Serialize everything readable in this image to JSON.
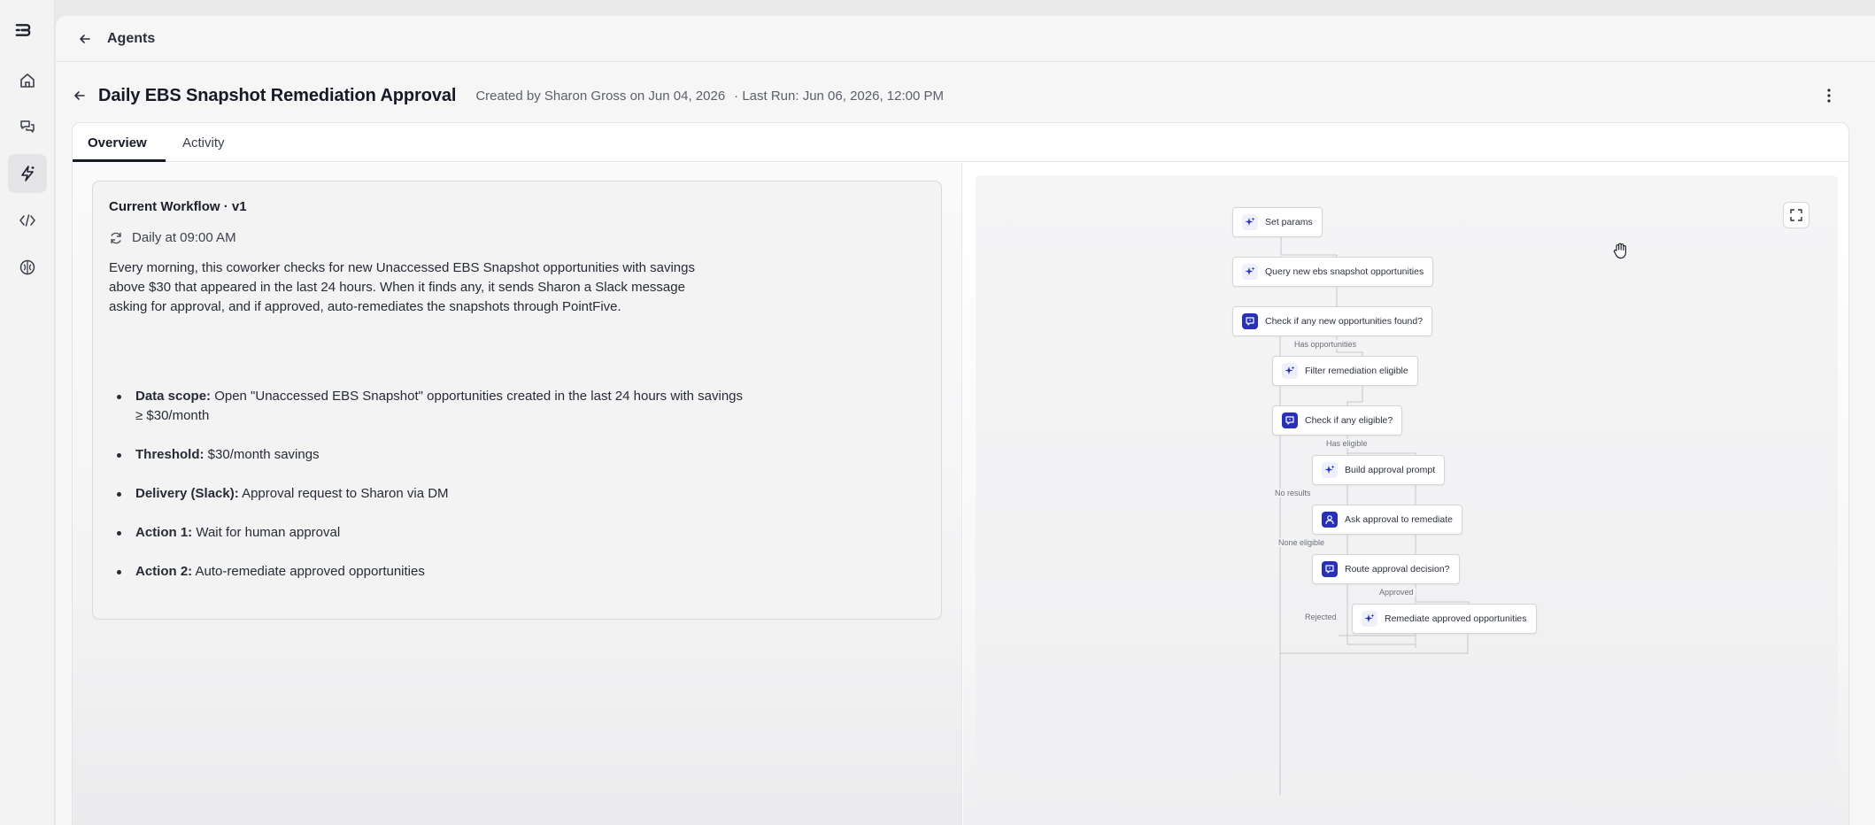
{
  "nav": {
    "items": [
      {
        "name": "home",
        "icon": "home-icon"
      },
      {
        "name": "chat",
        "icon": "chat-bubbles-icon"
      },
      {
        "name": "agents",
        "icon": "lightning-sparkle-icon",
        "active": true
      },
      {
        "name": "code",
        "icon": "code-brackets-icon"
      },
      {
        "name": "brain",
        "icon": "brain-icon"
      }
    ]
  },
  "topbar": {
    "breadcrumb": "Agents"
  },
  "header": {
    "title": "Daily EBS Snapshot Remediation Approval",
    "created": "Created by Sharon Gross on Jun 04, 2026",
    "last_run": "· Last Run: Jun 06, 2026, 12:00 PM"
  },
  "tabs": [
    {
      "label": "Overview",
      "active": true
    },
    {
      "label": "Activity",
      "active": false
    }
  ],
  "workflow": {
    "title": "Current Workflow · v1",
    "schedule": "Daily at 09:00 AM",
    "description": "Every morning, this coworker checks for new Unaccessed EBS Snapshot opportunities with savings above $30 that appeared in the last 24 hours. When it finds any, it sends Sharon a Slack message asking for approval, and if approved, auto-remediates the snapshots through PointFive.",
    "bullets": [
      {
        "label": "Data scope:",
        "text": " Open \"Unaccessed EBS Snapshot\" opportunities created in the last 24 hours with savings ≥ $30/month"
      },
      {
        "label": "Threshold:",
        "text": " $30/month savings"
      },
      {
        "label": "Delivery (Slack):",
        "text": " Approval request to Sharon via DM"
      },
      {
        "label": "Action 1:",
        "text": " Wait for human approval"
      },
      {
        "label": "Action 2:",
        "text": " Auto-remediate approved opportunities"
      }
    ]
  },
  "flow": {
    "nodes": [
      {
        "label": "Set params",
        "icon": "sparkle-icon"
      },
      {
        "label": "Query new ebs snapshot opportunities",
        "icon": "sparkle-icon"
      },
      {
        "label": "Check if any new opportunities found?",
        "icon": "branch-icon"
      },
      {
        "label": "Filter remediation eligible",
        "icon": "sparkle-icon"
      },
      {
        "label": "Check if any eligible?",
        "icon": "branch-icon"
      },
      {
        "label": "Build approval prompt",
        "icon": "sparkle-icon"
      },
      {
        "label": "Ask approval to remediate",
        "icon": "person-icon"
      },
      {
        "label": "Route approval decision?",
        "icon": "branch-icon"
      },
      {
        "label": "Remediate approved opportunities",
        "icon": "sparkle-icon"
      }
    ],
    "edge_labels": {
      "has_opportunities": "Has opportunities",
      "has_eligible": "Has eligible",
      "no_results": "No results",
      "none_eligible": "None eligible",
      "approved": "Approved",
      "rejected": "Rejected"
    }
  },
  "colors": {
    "accent": "#2830b8",
    "text": "#151a24"
  }
}
